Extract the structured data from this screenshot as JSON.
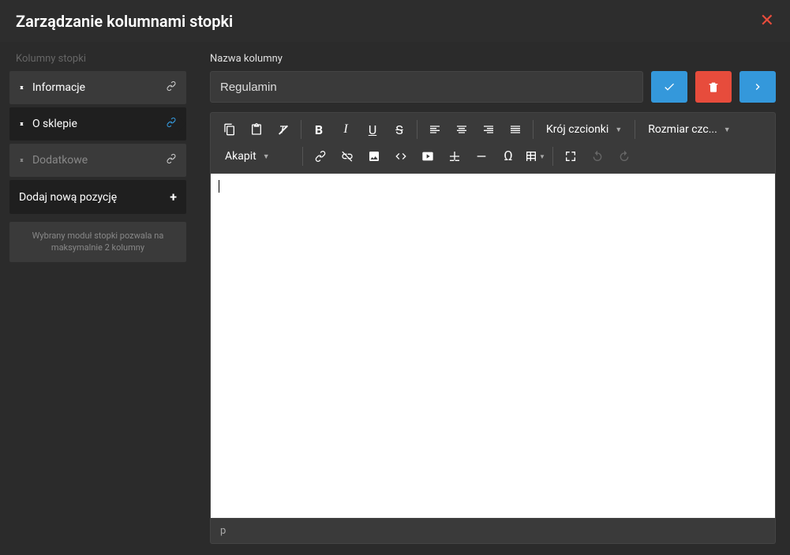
{
  "modal": {
    "title": "Zarządzanie kolumnami stopki"
  },
  "sidebar": {
    "label": "Kolumny stopki",
    "items": [
      {
        "label": "Informacje",
        "active": false
      },
      {
        "label": "O sklepie",
        "active": true
      },
      {
        "label": "Dodatkowe",
        "active": false
      }
    ],
    "add_label": "Dodaj nową pozycję",
    "hint": "Wybrany moduł stopki pozwala na maksymalnie 2 kolumny"
  },
  "main": {
    "field_label": "Nazwa kolumny",
    "input_value": "Regulamin"
  },
  "editor": {
    "font_family_label": "Krój czcionki",
    "font_size_label": "Rozmiar czc...",
    "format_label": "Akapit",
    "content": "",
    "status_path": "p"
  }
}
